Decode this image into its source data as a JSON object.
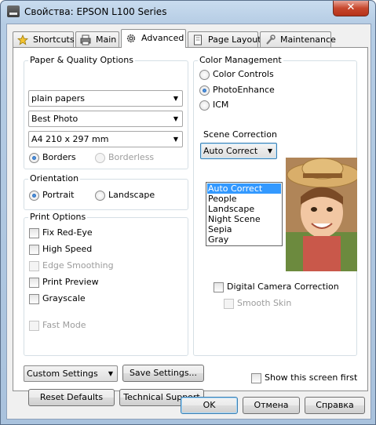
{
  "window": {
    "title": "Свойства: EPSON L100 Series",
    "close_glyph": "✕"
  },
  "tabs": [
    {
      "label": "Shortcuts",
      "icon": "star-icon"
    },
    {
      "label": "Main",
      "icon": "printer-icon"
    },
    {
      "label": "Advanced",
      "icon": "gear-icon"
    },
    {
      "label": "Page Layout",
      "icon": "page-icon"
    },
    {
      "label": "Maintenance",
      "icon": "wrench-icon"
    }
  ],
  "active_tab": "Advanced",
  "paper_quality": {
    "group_label": "Paper & Quality Options",
    "paper_type": "plain papers",
    "quality": "Best Photo",
    "paper_size": "A4 210 x 297 mm",
    "borders_label": "Borders",
    "borderless_label": "Borderless",
    "selected": "Borders"
  },
  "orientation": {
    "group_label": "Orientation",
    "portrait_label": "Portrait",
    "landscape_label": "Landscape",
    "selected": "Portrait"
  },
  "print_options": {
    "group_label": "Print Options",
    "fix_red_eye": "Fix Red-Eye",
    "high_speed": "High Speed",
    "edge_smoothing": "Edge Smoothing",
    "print_preview": "Print Preview",
    "grayscale": "Grayscale",
    "fast_mode": "Fast Mode"
  },
  "color_management": {
    "group_label": "Color Management",
    "color_controls": "Color Controls",
    "photo_enhance": "PhotoEnhance",
    "icm": "ICM",
    "selected": "PhotoEnhance",
    "scene_correction_label": "Scene Correction",
    "scene_value": "Auto Correct",
    "scene_options": [
      "Auto Correct",
      "People",
      "Landscape",
      "Night Scene",
      "Sepia",
      "Gray"
    ],
    "digital_camera_correction": "Digital Camera Correction",
    "smooth_skin": "Smooth Skin"
  },
  "footer": {
    "settings_combo": "Custom Settings",
    "save_settings": "Save Settings...",
    "show_screen_first": "Show this screen first",
    "reset_defaults": "Reset Defaults",
    "technical_support": "Technical Support"
  },
  "dialog_buttons": {
    "ok": "OK",
    "cancel": "Отмена",
    "help": "Справка"
  },
  "colors": {
    "selection": "#3399ff",
    "titlebar": "#b5cce4",
    "close": "#c7472d"
  }
}
